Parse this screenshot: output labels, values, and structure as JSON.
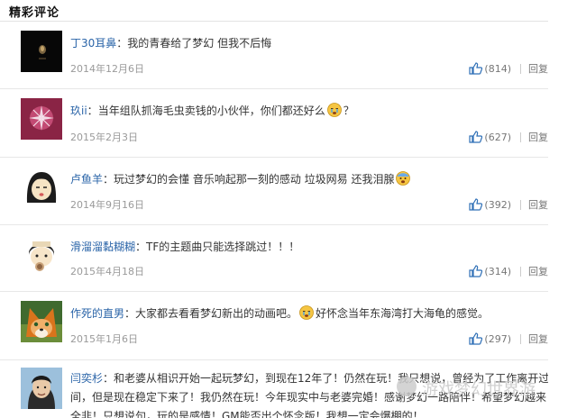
{
  "header": {
    "title": "精彩评论"
  },
  "comments": [
    {
      "user": "丁30耳鼻",
      "text": "我的青春给了梦幻 但我不后悔",
      "date": "2014年12月6日",
      "likes": "(814)",
      "reply": "回复",
      "avatar_colors": [
        "#0a0a0a",
        "#6b5a3a"
      ]
    },
    {
      "user": "玖ii",
      "text": "当年组队抓海毛虫卖钱的小伙伴，你们都还好么",
      "text_after": "？",
      "emoji": "crying-face",
      "date": "2015年2月3日",
      "likes": "(627)",
      "reply": "回复",
      "avatar_colors": [
        "#7a1f3d",
        "#f0d6e4"
      ]
    },
    {
      "user": "卢鱼羊",
      "text": "玩过梦幻的会懂 音乐响起那一刻的感动 垃圾网易 还我泪腺",
      "emoji": "fearful-face",
      "date": "2014年9月16日",
      "likes": "(392)",
      "reply": "回复",
      "avatar_colors": [
        "#f4e6c8",
        "#222222"
      ]
    },
    {
      "user": "滑溜溜黏糊糊",
      "text": "TF的主题曲只能选择跳过！！！",
      "date": "2015年4月18日",
      "likes": "(314)",
      "reply": "回复",
      "avatar_colors": [
        "#f6e3c8",
        "#2b2b2b"
      ]
    },
    {
      "user": "作死的直男",
      "text": "大家都去看看梦幻新出的动画吧。",
      "text_after": "好怀念当年东海湾打大海龟的感觉。",
      "emoji": "crying-face",
      "date": "2015年1月6日",
      "likes": "(297)",
      "reply": "回复",
      "avatar_colors": [
        "#d9771f",
        "#3b6b2a"
      ]
    },
    {
      "user": "闫奕杉",
      "lines": [
        "：和老婆从相识开始一起玩梦幻，到现在12年了！仍然在玩！我只想说，曾经为了工作离开过一段时",
        "间，但是现在稳定下来了！我仍然在玩！今年现实中与老婆完婚！感谢梦幻一路陪伴！希望梦幻越来",
        "全非！只想说句，玩的是感情！GM能否出个怀念版！我想一定会爆棚的！"
      ],
      "avatar_colors": [
        "#8fb6d6",
        "#1d1d1d"
      ]
    }
  ],
  "watermark": {
    "text": "游戏梦幻世界游"
  }
}
